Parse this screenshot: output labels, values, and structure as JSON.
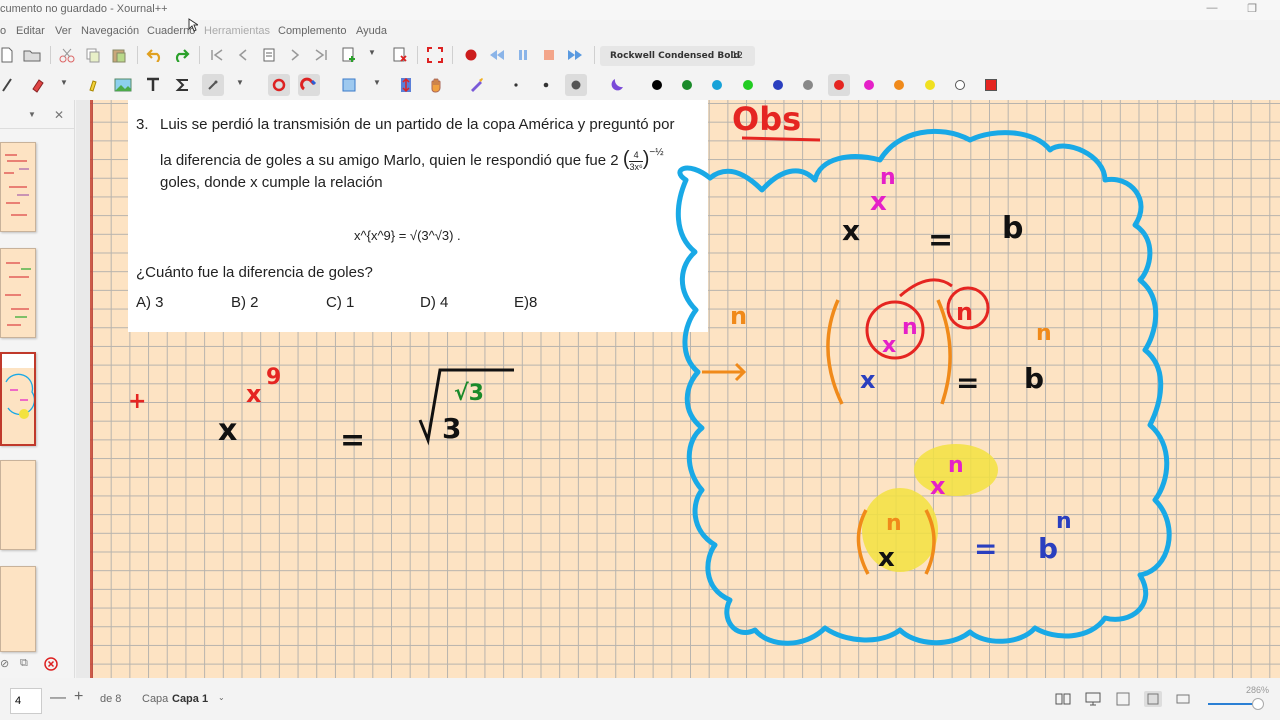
{
  "window": {
    "title": "cumento no guardado - Xournal++",
    "minimize": "—",
    "maximize": "❐"
  },
  "menu": {
    "items": [
      "Editar",
      "Ver",
      "Navegación",
      "Cuaderno",
      "Herramientas",
      "Complemento",
      "Ayuda"
    ]
  },
  "toolbar": {
    "font_name": "Rockwell Condensed Bold",
    "font_size": "12",
    "pen_colors": [
      "#000000",
      "#1a8a2a",
      "#17a2d8",
      "#22cc22",
      "#2a3fbf",
      "#888888",
      "#e52521",
      "#e520c8",
      "#f08a1a",
      "#f0e020",
      "#ffffff"
    ],
    "active_color": "#e52521",
    "record_color": "#cc1d1d"
  },
  "problem": {
    "number": "3.",
    "line1": "Luis se perdió la transmisión de un partido de la copa América y preguntó por",
    "line2_prefix": "la diferencia de goles a su amigo Marlo, quien le respondió que fue 2",
    "frac_num": "4",
    "frac_den": "3x⁶",
    "exponent": "−½",
    "line3": "goles, donde x cumple la relación",
    "equation": "x^{x^9} = √(3^√3) .",
    "question": "¿Cuánto fue la diferencia de goles?",
    "answers": [
      "A) 3",
      "B) 2",
      "C) 1",
      "D) 4",
      "E)8"
    ]
  },
  "ink": {
    "obs": "Obs",
    "x_base": "x",
    "x_exp": "x",
    "nine": "9",
    "equals": "=",
    "three": "3",
    "root3": "√3",
    "n": "n",
    "b": "b",
    "marker": "+",
    "colors": {
      "cloud": "#19a9e6",
      "red": "#e52521",
      "magenta": "#e520c8",
      "orange": "#f08a1a",
      "blue": "#2a3fbf",
      "green": "#1a8a2a",
      "yellow": "#f3e240"
    }
  },
  "status": {
    "page": "4",
    "of_pages": "de 8",
    "layer_label": "Capa",
    "layer_value": "Capa 1",
    "zoom": "286%"
  }
}
